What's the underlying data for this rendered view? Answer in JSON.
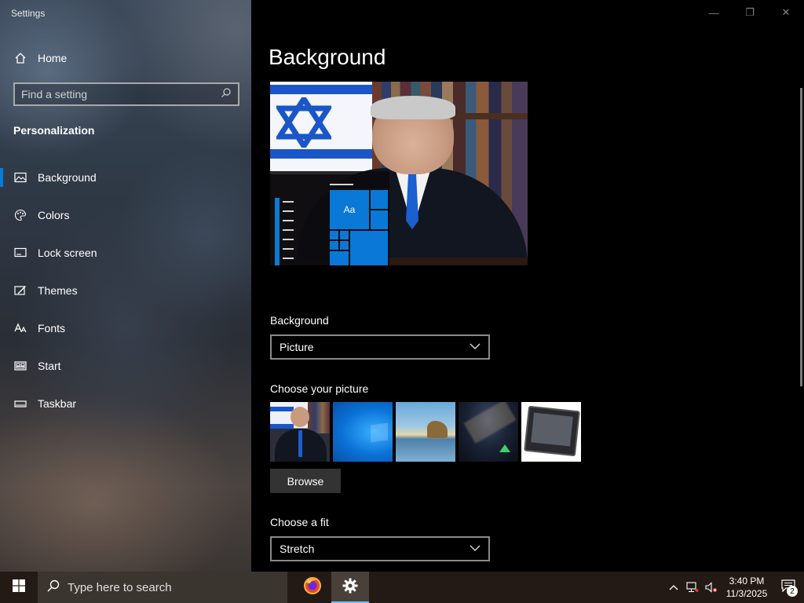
{
  "window": {
    "title": "Settings",
    "controls": {
      "minimize": "—",
      "maximize": "❐",
      "close": "✕"
    }
  },
  "sidebar": {
    "home_label": "Home",
    "search_placeholder": "Find a setting",
    "section_title": "Personalization",
    "items": [
      {
        "label": "Background",
        "icon": "image-icon",
        "active": true
      },
      {
        "label": "Colors",
        "icon": "palette-icon",
        "active": false
      },
      {
        "label": "Lock screen",
        "icon": "lock-screen-icon",
        "active": false
      },
      {
        "label": "Themes",
        "icon": "themes-icon",
        "active": false
      },
      {
        "label": "Fonts",
        "icon": "fonts-icon",
        "active": false
      },
      {
        "label": "Start",
        "icon": "start-icon",
        "active": false
      },
      {
        "label": "Taskbar",
        "icon": "taskbar-icon",
        "active": false
      }
    ]
  },
  "main": {
    "title": "Background",
    "preview": {
      "tile_label": "Aa"
    },
    "background_label": "Background",
    "background_value": "Picture",
    "choose_picture_label": "Choose your picture",
    "browse_label": "Browse",
    "choose_fit_label": "Choose a fit",
    "fit_value": "Stretch"
  },
  "taskbar": {
    "search_placeholder": "Type here to search",
    "apps": [
      {
        "name": "Firefox",
        "icon": "firefox-icon"
      },
      {
        "name": "Settings",
        "icon": "gear-icon",
        "active": true
      }
    ],
    "clock": {
      "time": "3:40 PM",
      "date": "11/3/2025"
    },
    "notification_count": "2"
  },
  "colors": {
    "accent": "#0a7bd6",
    "taskbar": "#241a15",
    "main_bg": "#000000"
  }
}
